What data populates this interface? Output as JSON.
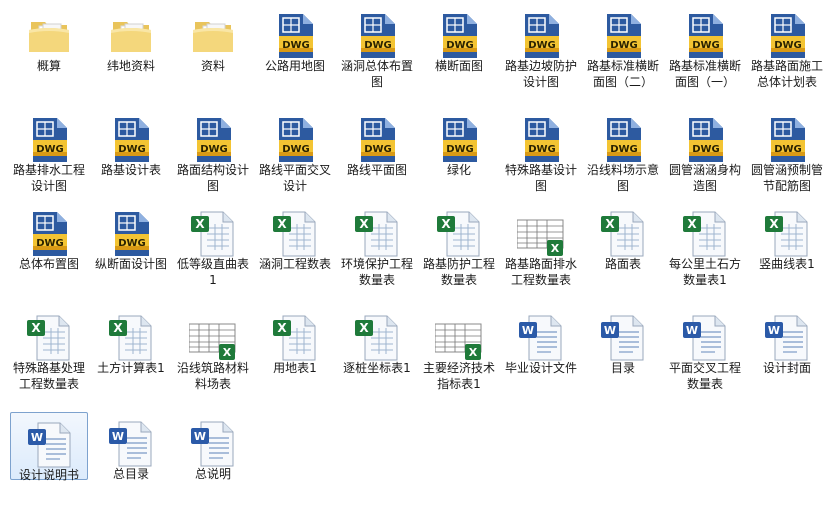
{
  "colors": {
    "dwg_text": "#2a2200",
    "folder": "#f1cf6a",
    "excel_green": "#1f7a3a",
    "word_blue": "#2b5aa8",
    "selection": "#cfe3fc"
  },
  "files": [
    {
      "label": "概算",
      "type": "folder"
    },
    {
      "label": "纬地资料",
      "type": "folder"
    },
    {
      "label": "资料",
      "type": "folder"
    },
    {
      "label": "公路用地图",
      "type": "dwg"
    },
    {
      "label": "涵洞总体布置图",
      "type": "dwg"
    },
    {
      "label": "横断面图",
      "type": "dwg"
    },
    {
      "label": "路基边坡防护设计图",
      "type": "dwg"
    },
    {
      "label": "路基标准横断面图（二）",
      "type": "dwg"
    },
    {
      "label": "路基标准横断面图（一）",
      "type": "dwg"
    },
    {
      "label": "路基路面施工总体计划表",
      "type": "dwg"
    },
    {
      "label": "路基排水工程设计图",
      "type": "dwg"
    },
    {
      "label": "路基设计表",
      "type": "dwg"
    },
    {
      "label": "路面结构设计图",
      "type": "dwg"
    },
    {
      "label": "路线平面交叉设计",
      "type": "dwg"
    },
    {
      "label": "路线平面图",
      "type": "dwg"
    },
    {
      "label": "绿化",
      "type": "dwg"
    },
    {
      "label": "特殊路基设计图",
      "type": "dwg"
    },
    {
      "label": "沿线料场示意图",
      "type": "dwg"
    },
    {
      "label": "圆管涵涵身构造图",
      "type": "dwg"
    },
    {
      "label": "圆管涵预制管节配筋图",
      "type": "dwg"
    },
    {
      "label": "总体布置图",
      "type": "dwg"
    },
    {
      "label": "纵断面设计图",
      "type": "dwg"
    },
    {
      "label": "低等级直曲表1",
      "type": "excel"
    },
    {
      "label": "涵洞工程数表",
      "type": "excel"
    },
    {
      "label": "环境保护工程数量表",
      "type": "excel"
    },
    {
      "label": "路基防护工程数量表",
      "type": "excel"
    },
    {
      "label": "路基路面排水工程数量表",
      "type": "excel-thumb"
    },
    {
      "label": "路面表",
      "type": "excel"
    },
    {
      "label": "每公里土石方数量表1",
      "type": "excel"
    },
    {
      "label": "竖曲线表1",
      "type": "excel"
    },
    {
      "label": "特殊路基处理工程数量表",
      "type": "excel"
    },
    {
      "label": "土方计算表1",
      "type": "excel"
    },
    {
      "label": "沿线筑路材料料场表",
      "type": "excel-thumb"
    },
    {
      "label": "用地表1",
      "type": "excel"
    },
    {
      "label": "逐桩坐标表1",
      "type": "excel"
    },
    {
      "label": "主要经济技术指标表1",
      "type": "excel-thumb"
    },
    {
      "label": "毕业设计文件",
      "type": "word"
    },
    {
      "label": "目录",
      "type": "word"
    },
    {
      "label": "平面交叉工程数量表",
      "type": "word"
    },
    {
      "label": "设计封面",
      "type": "word"
    },
    {
      "label": "设计说明书",
      "type": "word",
      "selected": true
    },
    {
      "label": "总目录",
      "type": "word"
    },
    {
      "label": "总说明",
      "type": "word"
    }
  ],
  "dwg_badge": "DWG"
}
